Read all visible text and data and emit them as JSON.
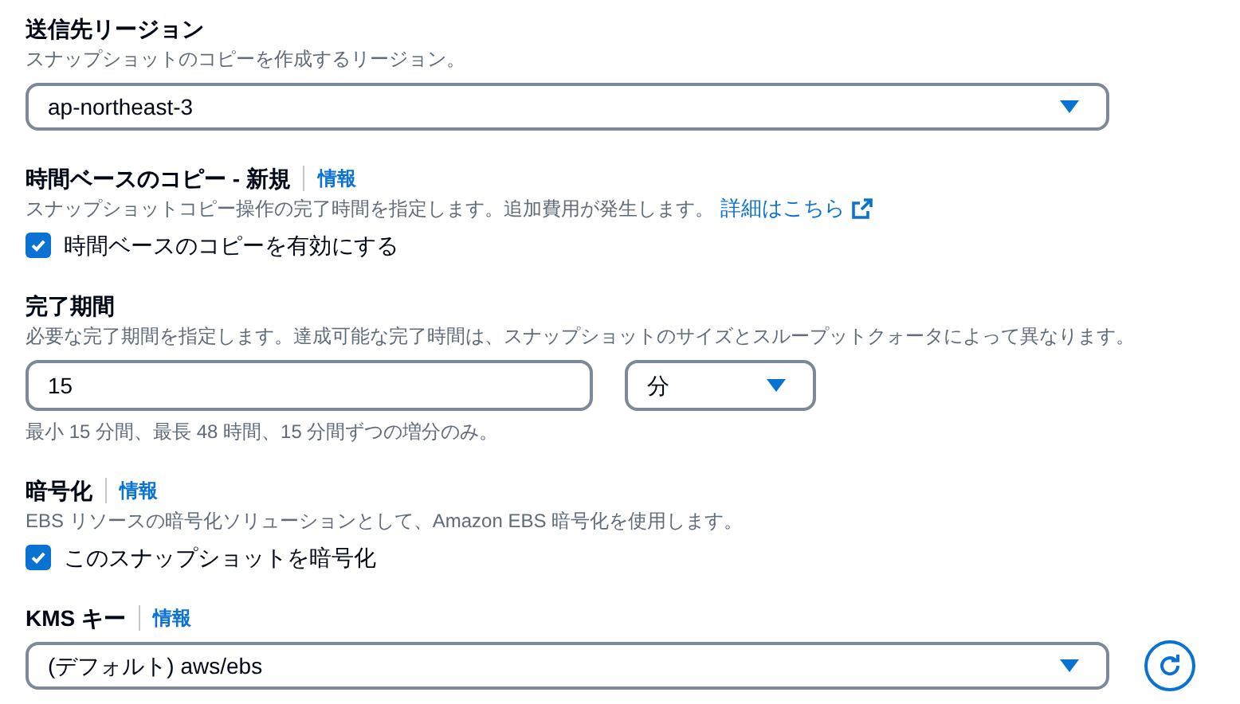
{
  "destination_region": {
    "label": "送信先リージョン",
    "description": "スナップショットのコピーを作成するリージョン。",
    "select": {
      "value": "ap-northeast-3"
    }
  },
  "time_based_copy": {
    "label": "時間ベースのコピー - 新規",
    "info": "情報",
    "description": "スナップショットコピー操作の完了時間を指定します。追加費用が発生します。",
    "link": "詳細はこちら",
    "checkbox": {
      "label": "時間ベースのコピーを有効にする",
      "checked": true
    }
  },
  "completion_period": {
    "label": "完了期間",
    "description": "必要な完了期間を指定します。達成可能な完了時間は、スナップショットのサイズとスループットクォータによって異なります。",
    "input": {
      "value": "15"
    },
    "unit_select": {
      "value": "分"
    },
    "hint": "最小 15 分間、最長 48 時間、15 分間ずつの増分のみ。"
  },
  "encryption": {
    "label": "暗号化",
    "info": "情報",
    "description": "EBS リソースの暗号化ソリューションとして、Amazon EBS 暗号化を使用します。",
    "checkbox": {
      "label": "このスナップショットを暗号化",
      "checked": true
    }
  },
  "kms_key": {
    "label": "KMS キー",
    "info": "情報",
    "select": {
      "value": "(デフォルト) aws/ebs"
    }
  }
}
